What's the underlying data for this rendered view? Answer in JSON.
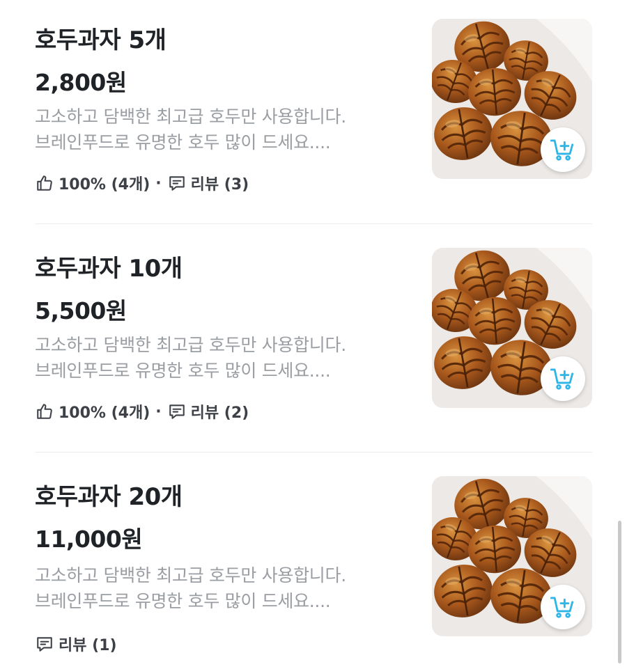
{
  "colors": {
    "text_primary": "#1f2226",
    "text_secondary": "#9a9ea3",
    "meta_text": "#3d4147",
    "accent_cart": "#2fb5e6",
    "divider": "#ececee"
  },
  "products": [
    {
      "name": "호두과자 5개",
      "price": "2,800원",
      "desc_line1": "고소하고 담백한 최고급 호두만 사용합니다.",
      "desc_line2": "브레인푸드로 유명한 호두 많이 드세요....",
      "like_text": "100% (4개)",
      "dot": "·",
      "review_text": "리뷰 (3)",
      "icons": [
        "thumbs-up-icon",
        "review-icon",
        "add-to-cart-icon"
      ]
    },
    {
      "name": "호두과자 10개",
      "price": "5,500원",
      "desc_line1": "고소하고 담백한 최고급 호두만 사용합니다.",
      "desc_line2": "브레인푸드로 유명한 호두 많이 드세요....",
      "like_text": "100% (4개)",
      "dot": "·",
      "review_text": "리뷰 (2)",
      "icons": [
        "thumbs-up-icon",
        "review-icon",
        "add-to-cart-icon"
      ]
    },
    {
      "name": "호두과자 20개",
      "price": "11,000원",
      "desc_line1": "고소하고 담백한 최고급 호두만 사용합니다.",
      "desc_line2": "브레인푸드로 유명한 호두 많이 드세요....",
      "review_text": "리뷰 (1)",
      "icons": [
        "review-icon",
        "add-to-cart-icon"
      ]
    }
  ]
}
